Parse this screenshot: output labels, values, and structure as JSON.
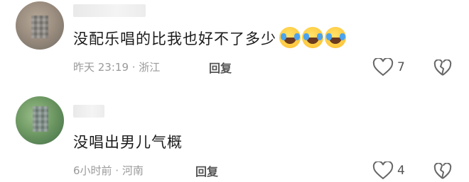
{
  "comments": [
    {
      "username": "",
      "text": "没配乐唱的比我也好不了多少",
      "emojis": [
        "laughing-crying-emoji",
        "laughing-crying-emoji",
        "laughing-crying-emoji"
      ],
      "meta": "昨天 23:19 · 浙江",
      "reply_label": "回复",
      "like_count": "7"
    },
    {
      "username": "",
      "text": "没唱出男儿气概",
      "emojis": [],
      "meta": "6小时前 · 河南",
      "reply_label": "回复",
      "like_count": "4"
    }
  ],
  "icons": {
    "like": "heart-icon",
    "dislike": "broken-heart-icon"
  },
  "colors": {
    "text": "#1b1b1b",
    "meta": "#9a9a9a",
    "reply": "#555555",
    "emoji": "#ffc83d"
  }
}
